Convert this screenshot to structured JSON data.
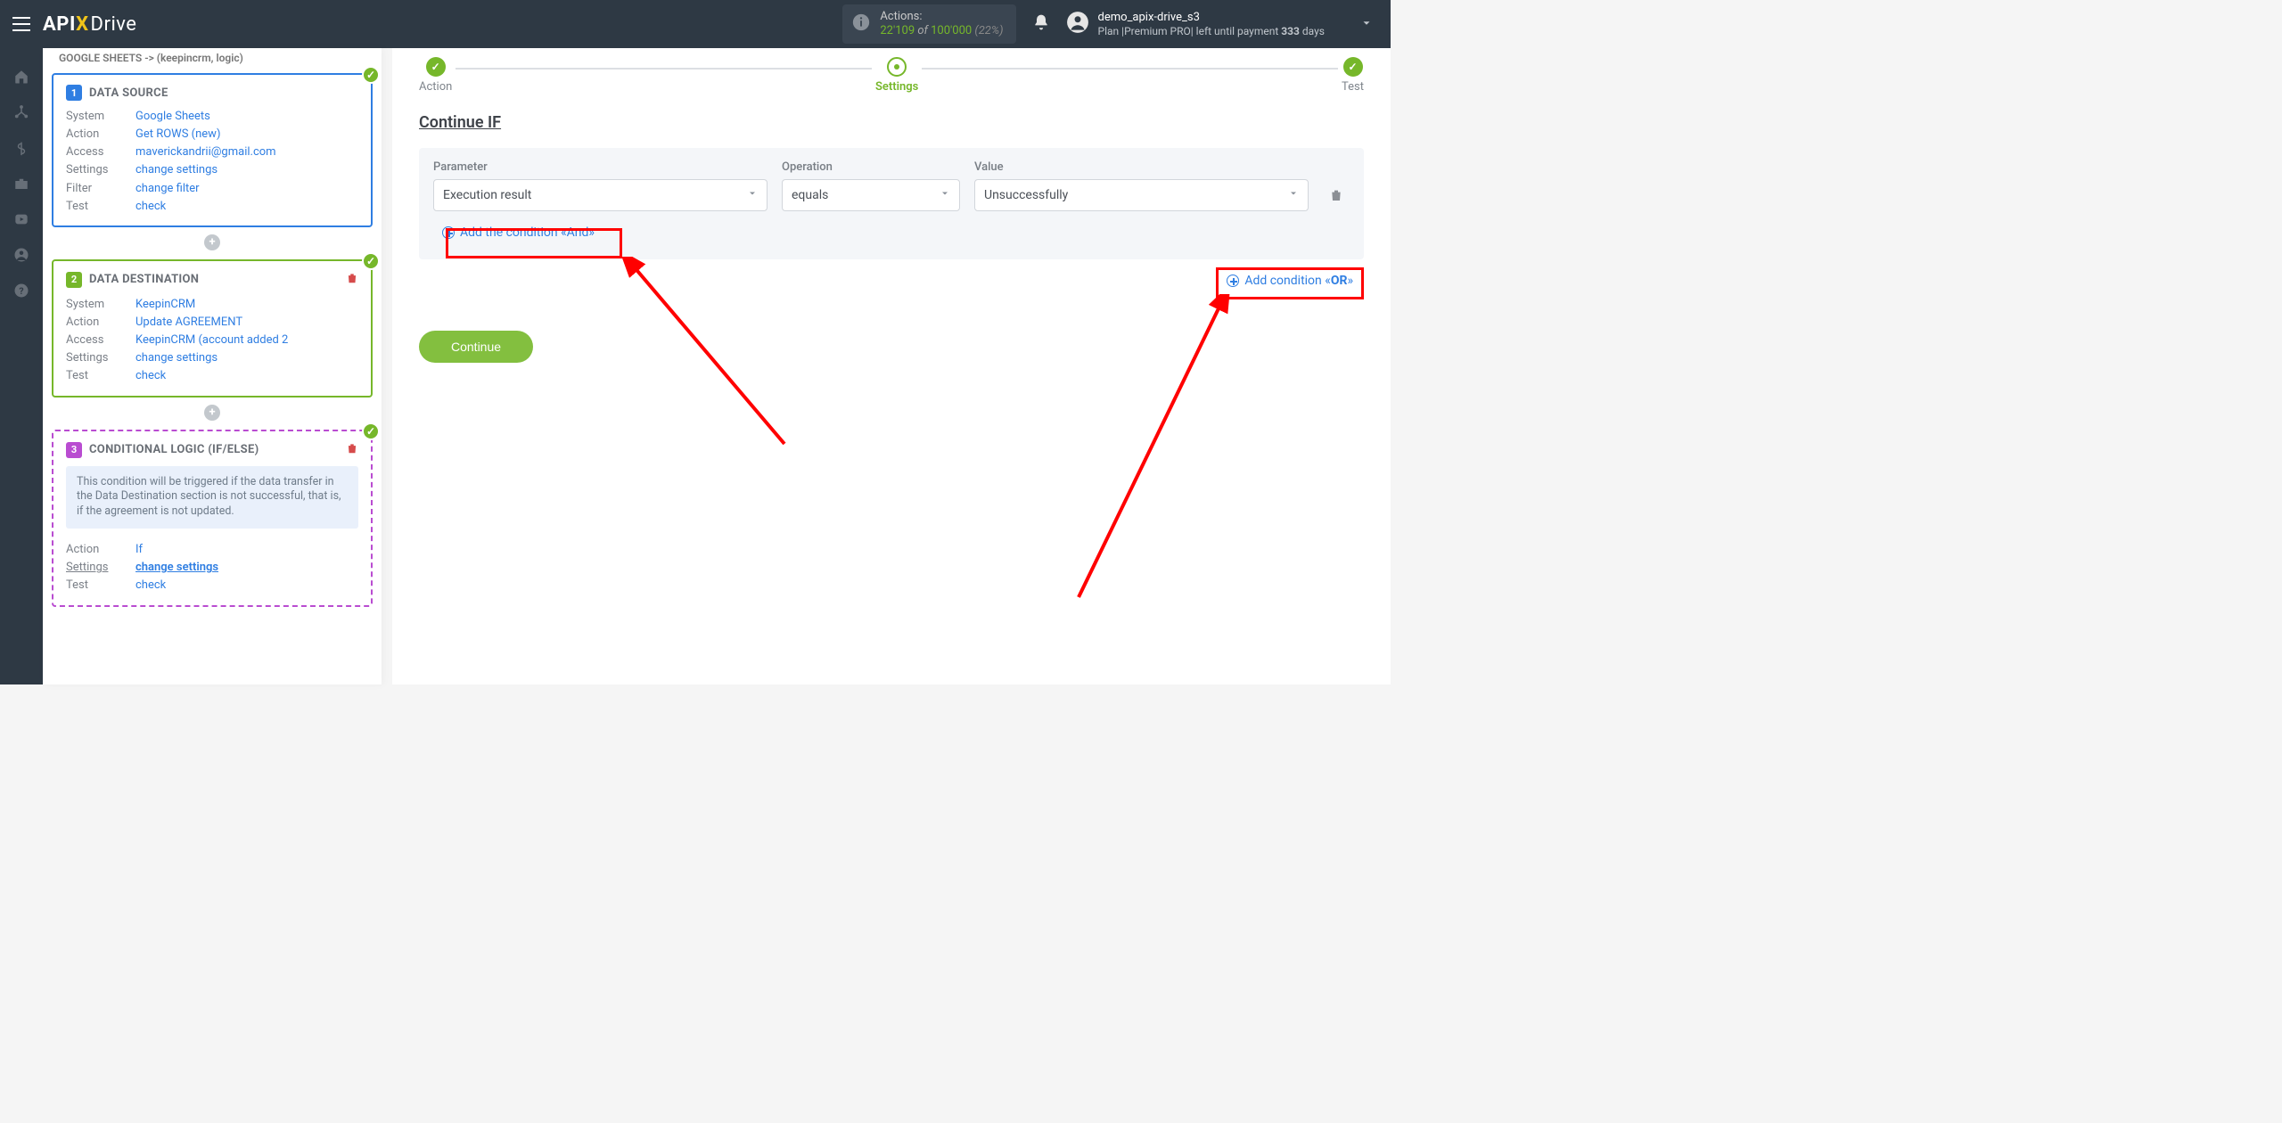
{
  "header": {
    "logo_api": "API",
    "logo_x": "X",
    "logo_drive": "Drive",
    "actions_label": "Actions:",
    "actions_used": "22'109",
    "actions_of": " of ",
    "actions_total": "100'000",
    "actions_pct": " (22%)",
    "username": "demo_apix-drive_s3",
    "plan_prefix": "Plan |",
    "plan_name": "Premium PRO",
    "plan_suffix1": "| left until payment ",
    "plan_days": "333",
    "plan_suffix2": " days"
  },
  "flow_title": "GOOGLE SHEETS -> (keepincrm, logic)",
  "card1": {
    "title": "DATA SOURCE",
    "num": "1",
    "rows": {
      "system_k": "System",
      "system_v": "Google Sheets",
      "action_k": "Action",
      "action_v": "Get ROWS (new)",
      "access_k": "Access",
      "access_v": "maverickandrii@gmail.com",
      "settings_k": "Settings",
      "settings_v": "change settings",
      "filter_k": "Filter",
      "filter_v": "change filter",
      "test_k": "Test",
      "test_v": "check"
    }
  },
  "card2": {
    "title": "DATA DESTINATION",
    "num": "2",
    "rows": {
      "system_k": "System",
      "system_v": "KeepinCRM",
      "action_k": "Action",
      "action_v": "Update AGREEMENT",
      "access_k": "Access",
      "access_v": "KeepinCRM (account added 2",
      "settings_k": "Settings",
      "settings_v": "change settings",
      "test_k": "Test",
      "test_v": "check"
    }
  },
  "card3": {
    "title": "CONDITIONAL LOGIC (IF/ELSE)",
    "num": "3",
    "note": "This condition will be triggered if the data transfer in the Data Destination section is not successful, that is, if the agreement is not updated.",
    "rows": {
      "action_k": "Action",
      "action_v": "If",
      "settings_k": "Settings",
      "settings_v": "change settings",
      "test_k": "Test",
      "test_v": "check"
    }
  },
  "steps": {
    "action": "Action",
    "settings": "Settings",
    "test": "Test"
  },
  "section_title": "Continue IF",
  "cond": {
    "param_label": "Parameter",
    "param_value": "Execution result",
    "op_label": "Operation",
    "op_value": "equals",
    "val_label": "Value",
    "val_value": "Unsuccessfully"
  },
  "add_and": "Add the condition «And»",
  "add_or_prefix": "Add condition «",
  "add_or_bold": "OR",
  "add_or_suffix": "»",
  "continue": "Continue",
  "plus": "+"
}
